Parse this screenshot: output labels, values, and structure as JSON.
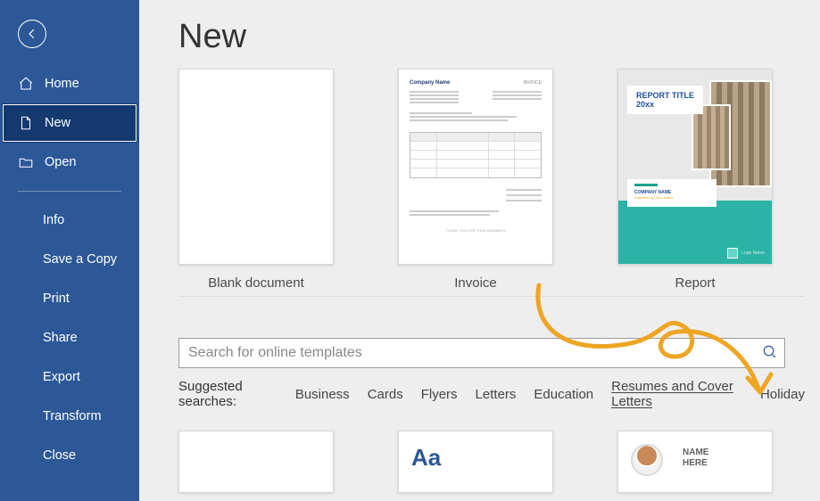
{
  "sidebar": {
    "primary": [
      {
        "label": "Home"
      },
      {
        "label": "New"
      },
      {
        "label": "Open"
      }
    ],
    "secondary": [
      {
        "label": "Info"
      },
      {
        "label": "Save a Copy"
      },
      {
        "label": "Print"
      },
      {
        "label": "Share"
      },
      {
        "label": "Export"
      },
      {
        "label": "Transform"
      },
      {
        "label": "Close"
      }
    ]
  },
  "page": {
    "title": "New"
  },
  "templates": [
    {
      "label": "Blank document"
    },
    {
      "label": "Invoice"
    },
    {
      "label": "Report"
    }
  ],
  "report_thumb": {
    "title_line1": "REPORT TITLE",
    "title_line2": "20xx",
    "company": "COMPANY NAME",
    "author": "Authored by: Your Name",
    "logo_text": "Logo\nName"
  },
  "invoice_thumb": {
    "company": "Company Name",
    "invoice_word": "INVOICE",
    "footer": "THANK YOU FOR YOUR BUSINESS"
  },
  "search": {
    "placeholder": "Search for online templates"
  },
  "suggested": {
    "label": "Suggested searches:",
    "links": [
      "Business",
      "Cards",
      "Flyers",
      "Letters",
      "Education",
      "Resumes and Cover Letters",
      "Holiday"
    ]
  },
  "bottom_templates": {
    "aa": "Aa",
    "name_line1": "NAME",
    "name_line2": "HERE"
  }
}
